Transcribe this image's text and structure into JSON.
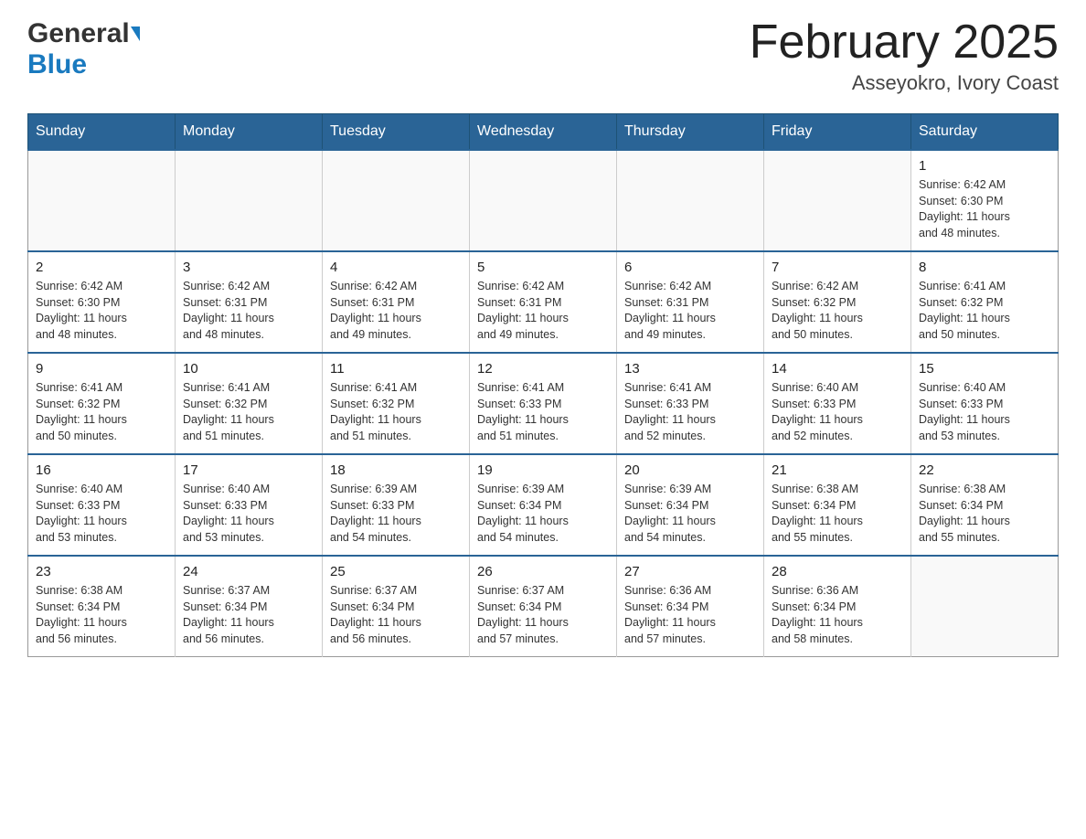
{
  "header": {
    "logo_general": "General",
    "logo_blue": "Blue",
    "title": "February 2025",
    "location": "Asseyokro, Ivory Coast"
  },
  "weekdays": [
    "Sunday",
    "Monday",
    "Tuesday",
    "Wednesday",
    "Thursday",
    "Friday",
    "Saturday"
  ],
  "weeks": [
    [
      {
        "day": "",
        "info": ""
      },
      {
        "day": "",
        "info": ""
      },
      {
        "day": "",
        "info": ""
      },
      {
        "day": "",
        "info": ""
      },
      {
        "day": "",
        "info": ""
      },
      {
        "day": "",
        "info": ""
      },
      {
        "day": "1",
        "info": "Sunrise: 6:42 AM\nSunset: 6:30 PM\nDaylight: 11 hours\nand 48 minutes."
      }
    ],
    [
      {
        "day": "2",
        "info": "Sunrise: 6:42 AM\nSunset: 6:30 PM\nDaylight: 11 hours\nand 48 minutes."
      },
      {
        "day": "3",
        "info": "Sunrise: 6:42 AM\nSunset: 6:31 PM\nDaylight: 11 hours\nand 48 minutes."
      },
      {
        "day": "4",
        "info": "Sunrise: 6:42 AM\nSunset: 6:31 PM\nDaylight: 11 hours\nand 49 minutes."
      },
      {
        "day": "5",
        "info": "Sunrise: 6:42 AM\nSunset: 6:31 PM\nDaylight: 11 hours\nand 49 minutes."
      },
      {
        "day": "6",
        "info": "Sunrise: 6:42 AM\nSunset: 6:31 PM\nDaylight: 11 hours\nand 49 minutes."
      },
      {
        "day": "7",
        "info": "Sunrise: 6:42 AM\nSunset: 6:32 PM\nDaylight: 11 hours\nand 50 minutes."
      },
      {
        "day": "8",
        "info": "Sunrise: 6:41 AM\nSunset: 6:32 PM\nDaylight: 11 hours\nand 50 minutes."
      }
    ],
    [
      {
        "day": "9",
        "info": "Sunrise: 6:41 AM\nSunset: 6:32 PM\nDaylight: 11 hours\nand 50 minutes."
      },
      {
        "day": "10",
        "info": "Sunrise: 6:41 AM\nSunset: 6:32 PM\nDaylight: 11 hours\nand 51 minutes."
      },
      {
        "day": "11",
        "info": "Sunrise: 6:41 AM\nSunset: 6:32 PM\nDaylight: 11 hours\nand 51 minutes."
      },
      {
        "day": "12",
        "info": "Sunrise: 6:41 AM\nSunset: 6:33 PM\nDaylight: 11 hours\nand 51 minutes."
      },
      {
        "day": "13",
        "info": "Sunrise: 6:41 AM\nSunset: 6:33 PM\nDaylight: 11 hours\nand 52 minutes."
      },
      {
        "day": "14",
        "info": "Sunrise: 6:40 AM\nSunset: 6:33 PM\nDaylight: 11 hours\nand 52 minutes."
      },
      {
        "day": "15",
        "info": "Sunrise: 6:40 AM\nSunset: 6:33 PM\nDaylight: 11 hours\nand 53 minutes."
      }
    ],
    [
      {
        "day": "16",
        "info": "Sunrise: 6:40 AM\nSunset: 6:33 PM\nDaylight: 11 hours\nand 53 minutes."
      },
      {
        "day": "17",
        "info": "Sunrise: 6:40 AM\nSunset: 6:33 PM\nDaylight: 11 hours\nand 53 minutes."
      },
      {
        "day": "18",
        "info": "Sunrise: 6:39 AM\nSunset: 6:33 PM\nDaylight: 11 hours\nand 54 minutes."
      },
      {
        "day": "19",
        "info": "Sunrise: 6:39 AM\nSunset: 6:34 PM\nDaylight: 11 hours\nand 54 minutes."
      },
      {
        "day": "20",
        "info": "Sunrise: 6:39 AM\nSunset: 6:34 PM\nDaylight: 11 hours\nand 54 minutes."
      },
      {
        "day": "21",
        "info": "Sunrise: 6:38 AM\nSunset: 6:34 PM\nDaylight: 11 hours\nand 55 minutes."
      },
      {
        "day": "22",
        "info": "Sunrise: 6:38 AM\nSunset: 6:34 PM\nDaylight: 11 hours\nand 55 minutes."
      }
    ],
    [
      {
        "day": "23",
        "info": "Sunrise: 6:38 AM\nSunset: 6:34 PM\nDaylight: 11 hours\nand 56 minutes."
      },
      {
        "day": "24",
        "info": "Sunrise: 6:37 AM\nSunset: 6:34 PM\nDaylight: 11 hours\nand 56 minutes."
      },
      {
        "day": "25",
        "info": "Sunrise: 6:37 AM\nSunset: 6:34 PM\nDaylight: 11 hours\nand 56 minutes."
      },
      {
        "day": "26",
        "info": "Sunrise: 6:37 AM\nSunset: 6:34 PM\nDaylight: 11 hours\nand 57 minutes."
      },
      {
        "day": "27",
        "info": "Sunrise: 6:36 AM\nSunset: 6:34 PM\nDaylight: 11 hours\nand 57 minutes."
      },
      {
        "day": "28",
        "info": "Sunrise: 6:36 AM\nSunset: 6:34 PM\nDaylight: 11 hours\nand 58 minutes."
      },
      {
        "day": "",
        "info": ""
      }
    ]
  ]
}
